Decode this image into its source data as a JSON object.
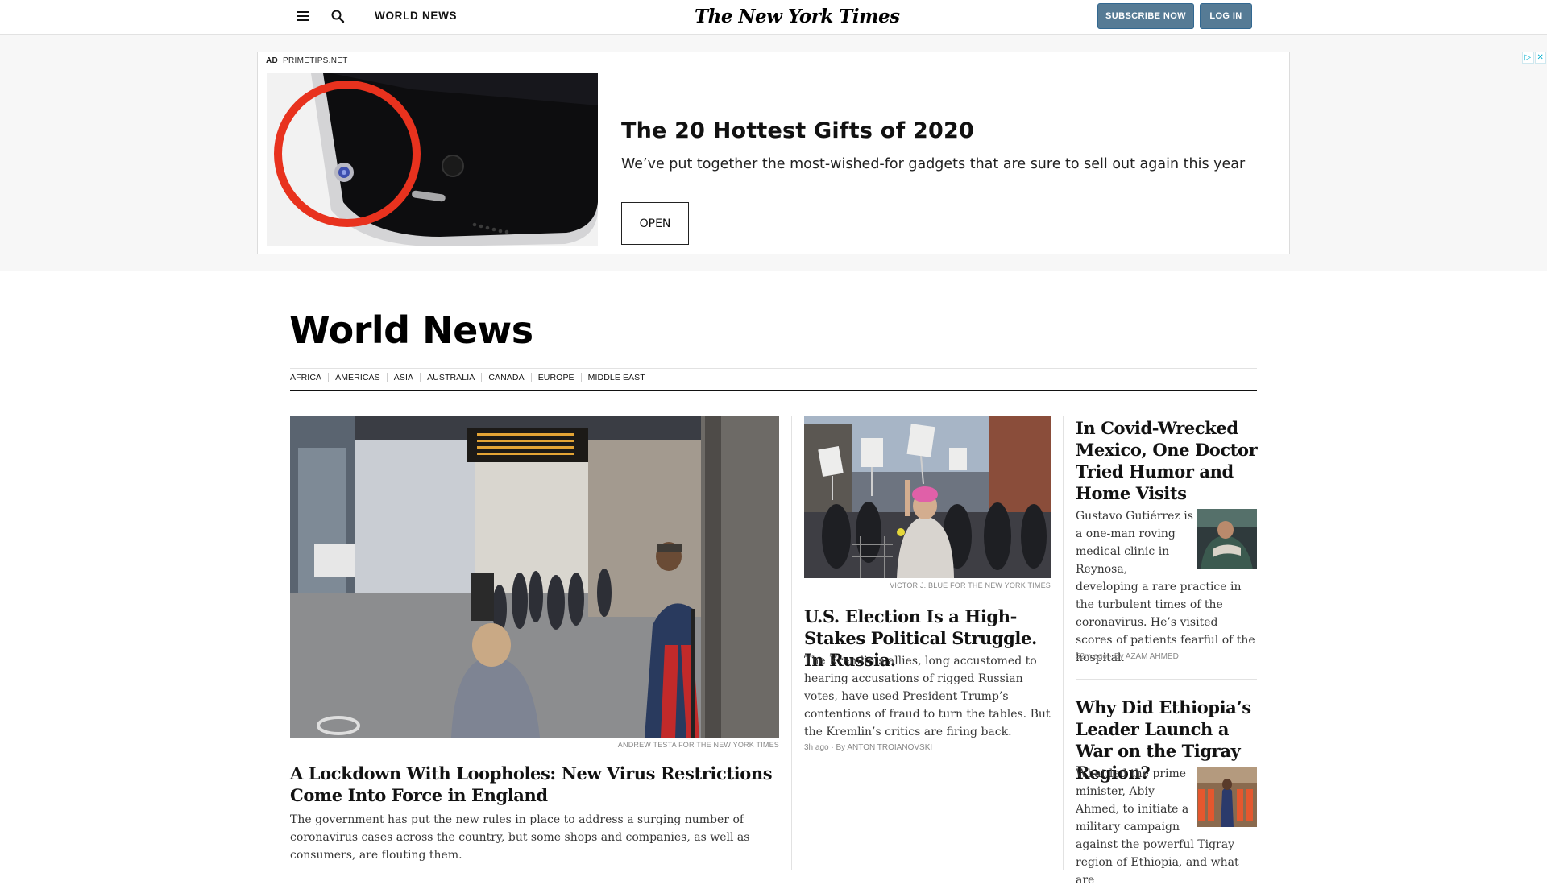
{
  "masthead": {
    "section_label": "WORLD NEWS",
    "logo_text": "The New York Times",
    "subscribe_label": "SUBSCRIBE NOW",
    "login_label": "LOG IN",
    "menu_icon": "hamburger-menu-icon",
    "search_icon": "search-icon"
  },
  "ad": {
    "badge": "AD",
    "sponsor": "PRIMETIPS.NET",
    "headline": "The 20 Hottest Gifts of 2020",
    "body": "We’ve put together the most-wished-for gadgets that are sure to sell out again this year",
    "cta_label": "OPEN",
    "choices_icons": [
      "adchoices-info-icon",
      "close-icon"
    ]
  },
  "section": {
    "title": "World News",
    "subnav": [
      "AFRICA",
      "AMERICAS",
      "ASIA",
      "AUSTRALIA",
      "CANADA",
      "EUROPE",
      "MIDDLE EAST"
    ]
  },
  "stories": [
    {
      "credit": "ANDREW TESTA FOR THE NEW YORK TIMES",
      "headline": "A Lockdown With Loopholes: New Virus Restrictions Come Into Force in England",
      "summary": "The government has put the new rules in place to address a surging number of coronavirus cases across the country, but some shops and companies, as well as consumers, are flouting them."
    },
    {
      "credit": "VICTOR J. BLUE FOR THE NEW YORK TIMES",
      "headline": "U.S. Election Is a High-Stakes Political Struggle. In Russia.",
      "summary": "The Kremlin’s allies, long accustomed to hearing accusations of rigged Russian votes, have used President Trump’s contentions of fraud to turn the tables. But the Kremlin’s critics are firing back.",
      "time": "3h ago",
      "byline": "By ANTON TROIANOVSKI"
    },
    {
      "headline": "In Covid-Wrecked Mexico, One Doctor Tried Humor and Home Visits",
      "summary": "Gustavo Gutiérrez is a one-man roving medical clinic in Reynosa, developing a rare practice in the turbulent times of the coronavirus. He’s visited scores of patients fearful of the hospital.",
      "time": "52m ago",
      "byline": "By AZAM AHMED"
    },
    {
      "headline": "Why Did Ethiopia’s Leader Launch a War on the Tigray Region?",
      "summary": "What led the prime minister, Abiy Ahmed, to initiate a military campaign against the powerful Tigray region of Ethiopia, and what are"
    }
  ],
  "colors": {
    "button_blue": "#567b95",
    "ad_ring_red": "#e8321e",
    "ad_band_gray": "#f7f7f7"
  }
}
